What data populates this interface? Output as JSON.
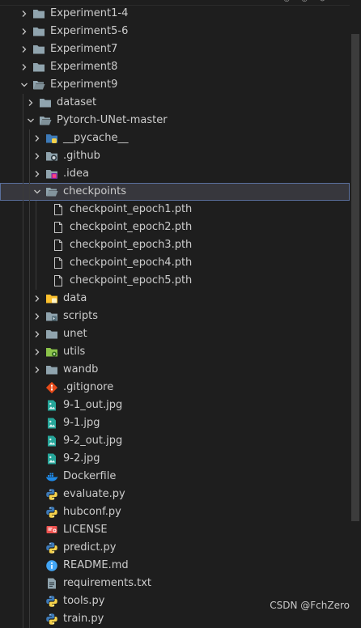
{
  "header": {
    "icons": [
      "new-file-icon",
      "new-folder-icon",
      "refresh-icon"
    ]
  },
  "tree": [
    {
      "depth": 0,
      "kind": "folder",
      "expanded": false,
      "label": "Experiment1-4",
      "icon": "folder-icon"
    },
    {
      "depth": 0,
      "kind": "folder",
      "expanded": false,
      "label": "Experiment5-6",
      "icon": "folder-icon"
    },
    {
      "depth": 0,
      "kind": "folder",
      "expanded": false,
      "label": "Experiment7",
      "icon": "folder-icon"
    },
    {
      "depth": 0,
      "kind": "folder",
      "expanded": false,
      "label": "Experiment8",
      "icon": "folder-icon"
    },
    {
      "depth": 0,
      "kind": "folder",
      "expanded": true,
      "label": "Experiment9",
      "icon": "folder-open-icon"
    },
    {
      "depth": 1,
      "kind": "folder",
      "expanded": false,
      "label": "dataset",
      "icon": "folder-icon"
    },
    {
      "depth": 1,
      "kind": "folder",
      "expanded": true,
      "label": "Pytorch-UNet-master",
      "icon": "folder-open-icon"
    },
    {
      "depth": 2,
      "kind": "folder",
      "expanded": false,
      "label": "__pycache__",
      "icon": "python-folder-icon"
    },
    {
      "depth": 2,
      "kind": "folder",
      "expanded": false,
      "label": ".github",
      "icon": "github-folder-icon"
    },
    {
      "depth": 2,
      "kind": "folder",
      "expanded": false,
      "label": ".idea",
      "icon": "idea-folder-icon"
    },
    {
      "depth": 2,
      "kind": "folder",
      "expanded": true,
      "selected": true,
      "label": "checkpoints",
      "icon": "folder-open-icon"
    },
    {
      "depth": 3,
      "kind": "file",
      "label": "checkpoint_epoch1.pth",
      "icon": "file-icon"
    },
    {
      "depth": 3,
      "kind": "file",
      "label": "checkpoint_epoch2.pth",
      "icon": "file-icon"
    },
    {
      "depth": 3,
      "kind": "file",
      "label": "checkpoint_epoch3.pth",
      "icon": "file-icon"
    },
    {
      "depth": 3,
      "kind": "file",
      "label": "checkpoint_epoch4.pth",
      "icon": "file-icon"
    },
    {
      "depth": 3,
      "kind": "file",
      "label": "checkpoint_epoch5.pth",
      "icon": "file-icon"
    },
    {
      "depth": 2,
      "kind": "folder",
      "expanded": false,
      "label": "data",
      "icon": "data-folder-icon"
    },
    {
      "depth": 2,
      "kind": "folder",
      "expanded": false,
      "label": "scripts",
      "icon": "scripts-folder-icon"
    },
    {
      "depth": 2,
      "kind": "folder",
      "expanded": false,
      "label": "unet",
      "icon": "folder-icon"
    },
    {
      "depth": 2,
      "kind": "folder",
      "expanded": false,
      "label": "utils",
      "icon": "utils-folder-icon"
    },
    {
      "depth": 2,
      "kind": "folder",
      "expanded": false,
      "label": "wandb",
      "icon": "folder-icon"
    },
    {
      "depth": 2,
      "kind": "file",
      "label": ".gitignore",
      "icon": "git-icon"
    },
    {
      "depth": 2,
      "kind": "file",
      "label": "9-1_out.jpg",
      "icon": "image-icon"
    },
    {
      "depth": 2,
      "kind": "file",
      "label": "9-1.jpg",
      "icon": "image-icon"
    },
    {
      "depth": 2,
      "kind": "file",
      "label": "9-2_out.jpg",
      "icon": "image-icon"
    },
    {
      "depth": 2,
      "kind": "file",
      "label": "9-2.jpg",
      "icon": "image-icon"
    },
    {
      "depth": 2,
      "kind": "file",
      "label": "Dockerfile",
      "icon": "docker-icon"
    },
    {
      "depth": 2,
      "kind": "file",
      "label": "evaluate.py",
      "icon": "python-icon"
    },
    {
      "depth": 2,
      "kind": "file",
      "label": "hubconf.py",
      "icon": "python-icon"
    },
    {
      "depth": 2,
      "kind": "file",
      "label": "LICENSE",
      "icon": "license-icon"
    },
    {
      "depth": 2,
      "kind": "file",
      "label": "predict.py",
      "icon": "python-icon"
    },
    {
      "depth": 2,
      "kind": "file",
      "label": "README.md",
      "icon": "info-icon"
    },
    {
      "depth": 2,
      "kind": "file",
      "label": "requirements.txt",
      "icon": "text-file-icon"
    },
    {
      "depth": 2,
      "kind": "file",
      "label": "tools.py",
      "icon": "python-icon"
    },
    {
      "depth": 2,
      "kind": "file",
      "label": "train.py",
      "icon": "python-icon"
    }
  ],
  "watermark": "CSDN @FchZero",
  "colors": {
    "background": "#1e1e1e",
    "text": "#cccccc",
    "selection": "#37373d",
    "selection_border": "#5a6f9c",
    "folder": "#90a4ae",
    "python_blue": "#3d7ab8",
    "python_yellow": "#f5d14a",
    "image_teal": "#26a69a",
    "git_orange": "#e64a19",
    "docker_blue": "#1e88e5",
    "license_red": "#ef5350",
    "info_blue": "#42a5f5"
  }
}
